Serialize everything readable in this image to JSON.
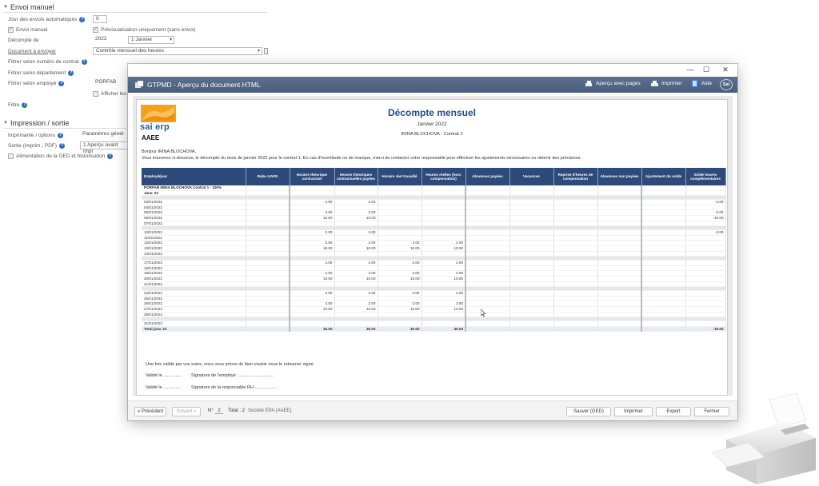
{
  "bg": {
    "sections": {
      "envoi": "Envoi manuel",
      "impression": "Impression / sortie"
    },
    "fields": {
      "jour_label": "Jour des envois automatiques",
      "jour_value": "0",
      "envoi_manuel": "Envoi manuel",
      "previsualisation": "Prévisualisation uniquement (sans envoi)",
      "decompte_label": "Décompte de",
      "decompte_year": "2022",
      "decompte_month": "1 Janvier",
      "document_label": "Document à envoyer",
      "document_value": "Contrôle mensuel des heures",
      "filtre_contrat": "Filtrer selon numéro de contrat",
      "filtre_dept": "Filtrer selon département",
      "filtre_employe": "Filtrer selon employé",
      "filtre_employe_value": "PORFAB",
      "afficher": "Afficher les",
      "filtre": "Filtre",
      "imprimante_label": "Imprimante / options",
      "imprimante_value": "Paramètres génér",
      "sortie_label": "Sortie (imprim., PDF)",
      "sortie_value": "1 Aperçu avant impr",
      "ged": "Alimentation de la GED et historisation"
    }
  },
  "window": {
    "controls": {
      "minimize": "—",
      "maximize": "☐",
      "close": "✕"
    },
    "title": "GTPMD - Aperçu du document HTML",
    "toolbar": {
      "preview_pages": "Aperçu avec pages",
      "print": "Imprimer",
      "help": "Aide",
      "brand": "Sai"
    }
  },
  "doc": {
    "logo_text": "sai erp",
    "company": "AAEE",
    "title": "Décompte mensuel",
    "period": "Janvier 2022",
    "employee_contract": "IRINA BLOCHOVA - Contrat 1",
    "greeting": "Bonjour IRINA BLOCHOVA,",
    "intro": "Vous trouverez ci-dessous, le décompte du mois de janvier 2022 pour le contrat 1. En cas d'incertitude ou de manque, merci de contacter votre responsable pour effectuer les ajustements nécessaires ou obtenir des précisions.",
    "columns": [
      "Employé/jour",
      "Rabu UAPE",
      "Horaire théorique contractuel",
      "Heures théoriques contractuelles payées",
      "Horaire réel travaillé",
      "Heures réelles (hors compensation)",
      "Absences payées",
      "Vacances",
      "Reprise d'heures de compensation",
      "Absences non payées",
      "Ajustement du solde",
      "Solde heures complémentaires"
    ],
    "group_label": "PORFAB IRINA BLOCHOVA Contrat 1 - 100%",
    "month_label": "Janv. 22",
    "rows": [
      {
        "gap": true
      },
      {
        "d": "03/01/2022",
        "c2": "2.00",
        "c3": "2.00",
        "c11": "-2.00"
      },
      {
        "d": "04/01/2022"
      },
      {
        "d": "05/01/2022",
        "c2": "2.00",
        "c3": "2.00",
        "c11": "-2.00"
      },
      {
        "d": "06/01/2022",
        "c2": "10.00",
        "c3": "10.00",
        "c11": "-10.00"
      },
      {
        "d": "07/01/2022"
      },
      {
        "gap": true
      },
      {
        "d": "10/01/2022",
        "c2": "2.00",
        "c3": "2.00",
        "c11": "-2.00"
      },
      {
        "d": "11/01/2022"
      },
      {
        "d": "12/01/2022",
        "c2": "2.00",
        "c3": "2.00",
        "c4": "2.00",
        "c5": "2.00"
      },
      {
        "d": "13/01/2022",
        "c2": "10.00",
        "c3": "10.00",
        "c4": "10.00",
        "c5": "10.00"
      },
      {
        "d": "14/01/2022"
      },
      {
        "gap": true
      },
      {
        "d": "17/01/2022",
        "c2": "2.00",
        "c3": "2.00",
        "c4": "2.00",
        "c5": "2.00"
      },
      {
        "d": "18/01/2022"
      },
      {
        "d": "19/01/2022",
        "c2": "2.00",
        "c3": "2.00",
        "c4": "2.00",
        "c5": "2.00"
      },
      {
        "d": "20/01/2022",
        "c2": "10.00",
        "c3": "10.00",
        "c4": "10.00",
        "c5": "10.00"
      },
      {
        "d": "21/01/2022"
      },
      {
        "gap": true
      },
      {
        "d": "24/01/2022",
        "c2": "2.00",
        "c3": "2.00",
        "c4": "2.00",
        "c5": "2.00"
      },
      {
        "d": "25/01/2022"
      },
      {
        "d": "26/01/2022",
        "c2": "2.00",
        "c3": "2.00",
        "c4": "2.00",
        "c5": "2.00"
      },
      {
        "d": "27/01/2022",
        "c2": "10.00",
        "c3": "10.00",
        "c4": "10.00",
        "c5": "10.00"
      },
      {
        "d": "28/01/2022"
      },
      {
        "gap": true
      },
      {
        "d": "31/01/2022"
      }
    ],
    "total": {
      "d": "Total janv. 22",
      "c2": "36.00",
      "c3": "36.00",
      "c4": "40.00",
      "c5": "40.00",
      "c11": "-16.00"
    },
    "closing": "Une fois validé par vos soins, nous vous prions de bien vouloir nous le retourner signé.",
    "valide1": "Validé le ...............",
    "sig1": "Signature de l'employé ..............................",
    "valide2": "Validé le ...............",
    "sig2": "Signature de la responsable RH .................."
  },
  "bottom": {
    "prev": "« Précédent",
    "next": "Suivant »",
    "no_label": "N°",
    "no_value": "2",
    "total": "Total : 2",
    "company": "Société EPA (AAEE)",
    "save_ged": "Sauver (GED)",
    "print": "Imprimer",
    "export": "Export",
    "close": "Fermer"
  },
  "colors": {
    "titlebar": "#4f6281",
    "table_header": "#2d4a7a",
    "doc_title": "#1f4e8c",
    "accent_info": "#2a6cc4"
  }
}
